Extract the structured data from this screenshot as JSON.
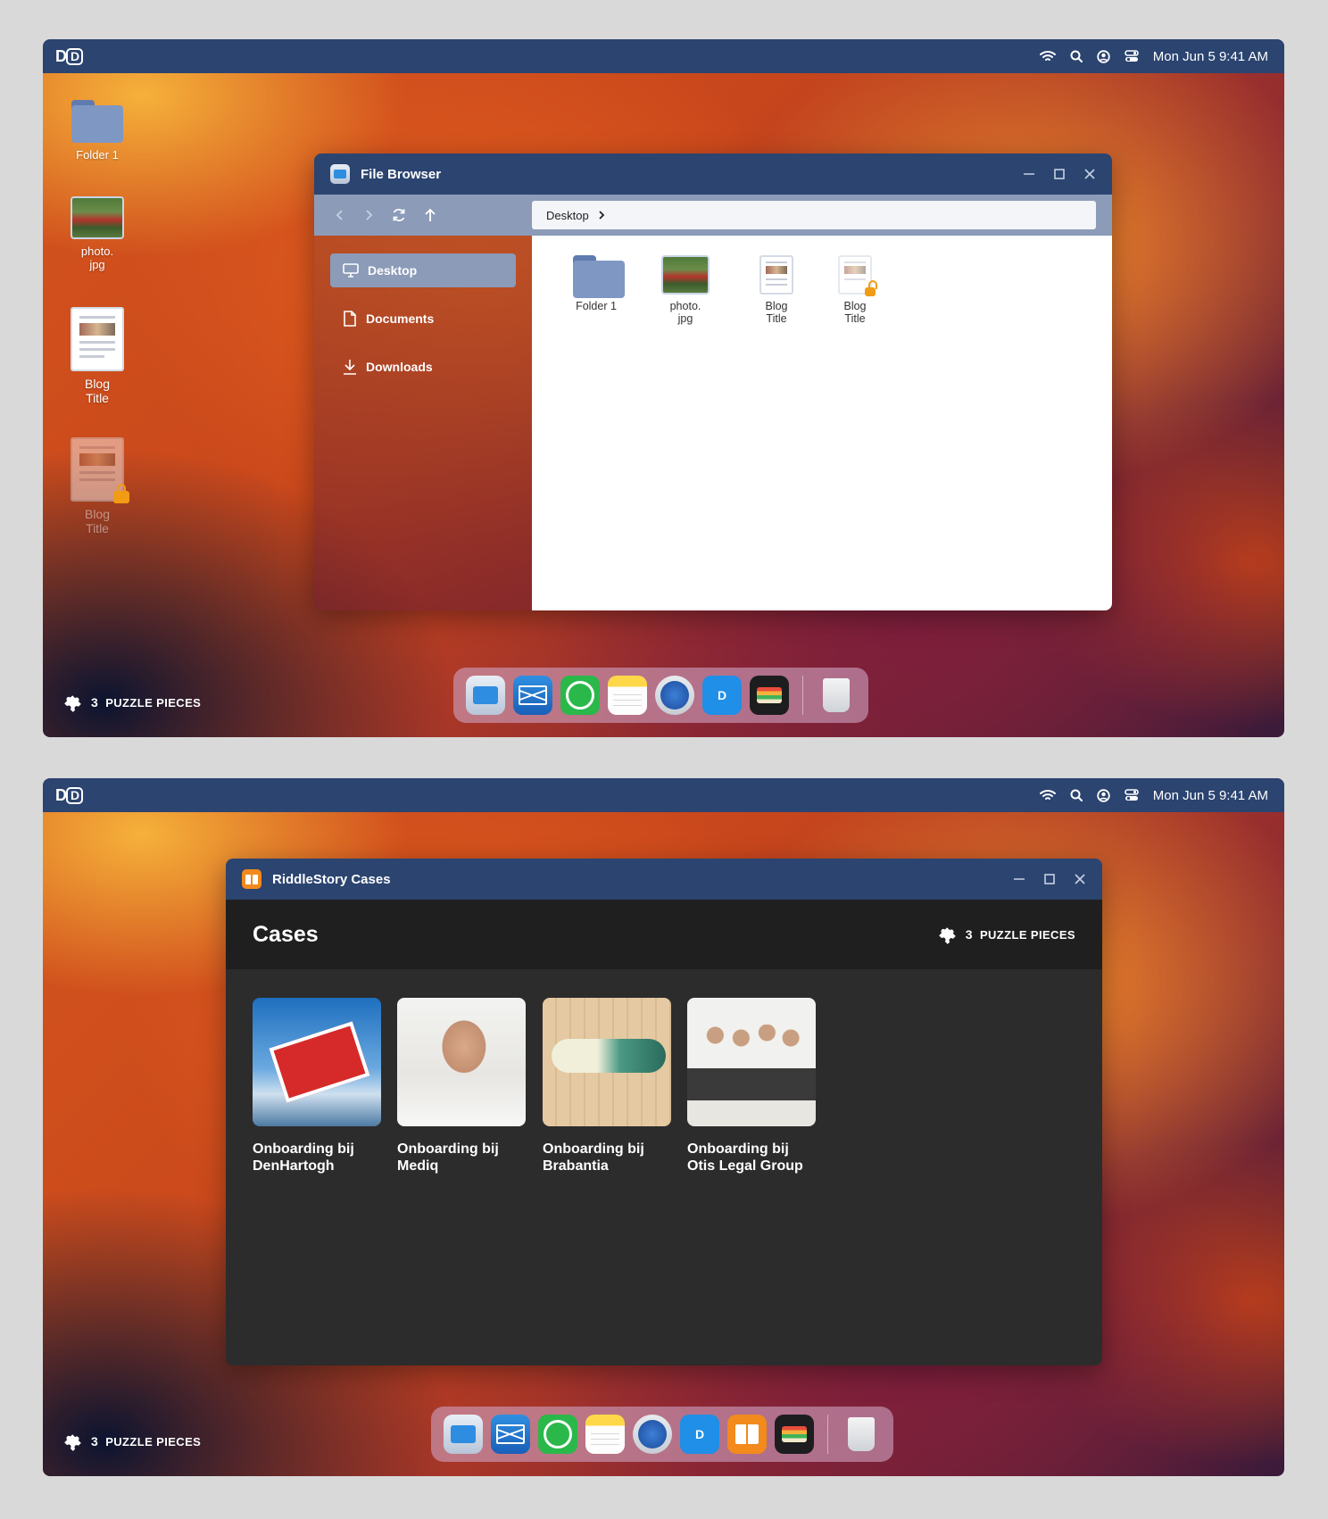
{
  "menubar": {
    "logo": "D",
    "logo_box": "D",
    "datetime": "Mon Jun 5  9:41 AM"
  },
  "desktop": {
    "icons": [
      {
        "label": "Folder 1",
        "icon": "folder-icon"
      },
      {
        "label": "photo.\njpg",
        "icon": "image-icon"
      },
      {
        "label": "Blog\nTitle",
        "icon": "document-icon"
      },
      {
        "label": "Blog\nTitle",
        "icon": "locked-document-icon"
      }
    ],
    "puzzle": {
      "count": "3",
      "label": "PUZZLE PIECES"
    }
  },
  "file_browser": {
    "title": "File Browser",
    "path": "Desktop",
    "sidebar": [
      {
        "label": "Desktop",
        "icon": "monitor-icon"
      },
      {
        "label": "Documents",
        "icon": "document-icon"
      },
      {
        "label": "Downloads",
        "icon": "download-icon"
      }
    ],
    "files": [
      {
        "label": "Folder 1",
        "icon": "folder-icon"
      },
      {
        "label": "photo.\njpg",
        "icon": "image-icon"
      },
      {
        "label": "Blog\nTitle",
        "icon": "document-icon"
      },
      {
        "label": "Blog\nTitle",
        "icon": "locked-document-icon"
      }
    ]
  },
  "riddlestory": {
    "title": "RiddleStory Cases",
    "heading": "Cases",
    "puzzle": {
      "count": "3",
      "label": "PUZZLE PIECES"
    },
    "cases": [
      {
        "label": "Onboarding bij DenHartogh"
      },
      {
        "label": "Onboarding bij Mediq"
      },
      {
        "label": "Onboarding bij Brabantia"
      },
      {
        "label": "Onboarding bij Otis Legal Group"
      }
    ]
  },
  "dock_top": [
    "files-icon",
    "mail-icon",
    "whatsapp-icon",
    "notes-icon",
    "safari-icon",
    "dd-app-icon",
    "wallet-icon",
    "trash-icon"
  ],
  "dock_bottom": [
    "files-icon",
    "mail-icon",
    "whatsapp-icon",
    "notes-icon",
    "safari-icon",
    "dd-app-icon",
    "books-icon",
    "wallet-icon",
    "trash-icon"
  ],
  "dd_app_text": "D",
  "colors": {
    "titlebar": "#2b4470",
    "accent_lock": "#f29b15",
    "toolbar": "#8b9bb8"
  }
}
